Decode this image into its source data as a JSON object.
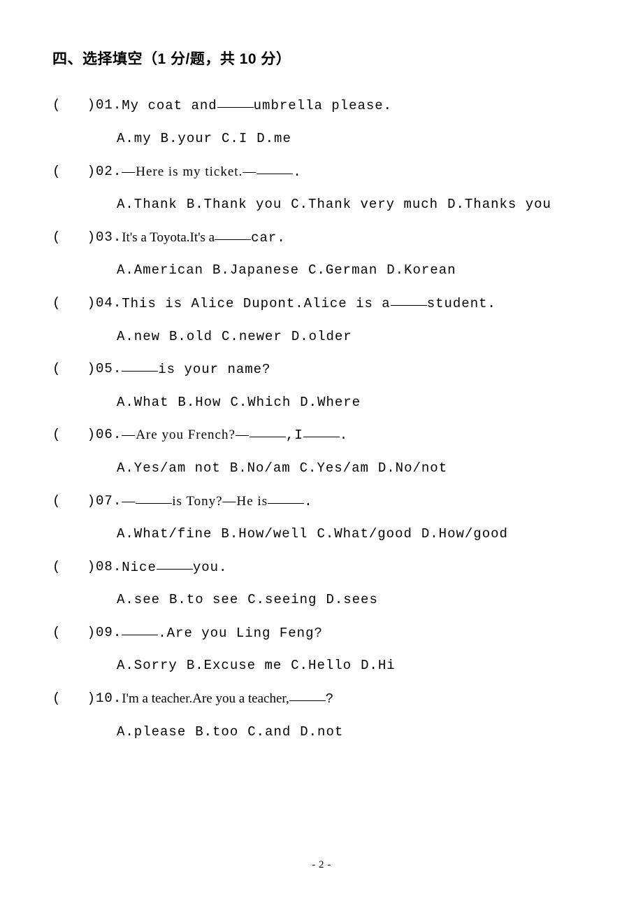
{
  "section_title": "四、选择填空（1 分/题，共 10 分）",
  "paren": "(   )",
  "questions": [
    {
      "num": "01.",
      "stem_pre": "My coat and",
      "stem_post": "umbrella please.",
      "opts": [
        "A.my",
        "B.your",
        "C.I",
        "D.me"
      ]
    },
    {
      "num": "02.",
      "stem_pre": "—Here is my ticket.—",
      "stem_post": ".",
      "opts": [
        "A.Thank",
        "B.Thank you",
        "C.Thank very much",
        "D.Thanks you"
      ]
    },
    {
      "num": "03.",
      "stem_pre": "It's a Toyota.It's a",
      "stem_post": "car.",
      "opts": [
        "A.American",
        "B.Japanese",
        "C.German",
        "D.Korean"
      ]
    },
    {
      "num": "04.",
      "stem_pre": "This is Alice Dupont.Alice is a",
      "stem_post": "student.",
      "opts": [
        "A.new",
        "B.old",
        "C.newer",
        "D.older"
      ]
    },
    {
      "num": "05.",
      "stem_pre": "",
      "stem_post": "is your name?",
      "opts": [
        "A.What",
        "B.How",
        "C.Which",
        "D.Where"
      ]
    },
    {
      "num": "06.",
      "stem_pre": "—Are you French?—",
      "stem_mid": ",I",
      "stem_post": ".",
      "opts": [
        "A.Yes/am not",
        "B.No/am",
        "C.Yes/am",
        "D.No/not"
      ]
    },
    {
      "num": "07.",
      "stem_pre": "—",
      "stem_mid": "is Tony?—He is",
      "stem_post": ".",
      "opts": [
        "A.What/fine",
        "B.How/well",
        "C.What/good",
        "D.How/good"
      ]
    },
    {
      "num": "08.",
      "stem_pre": "Nice",
      "stem_post": "you.",
      "opts": [
        "A.see",
        "B.to see",
        "C.seeing",
        "D.sees"
      ]
    },
    {
      "num": "09.",
      "stem_pre": "",
      "stem_post": ".Are you Ling Feng?",
      "opts": [
        "A.Sorry",
        "B.Excuse me",
        "C.Hello",
        "D.Hi"
      ]
    },
    {
      "num": "10.",
      "stem_pre": "I'm a teacher.Are you a teacher,",
      "stem_post": "?",
      "opts": [
        "A.please",
        "B.too",
        "C.and",
        "D.not"
      ]
    }
  ],
  "page_number": "- 2 -"
}
